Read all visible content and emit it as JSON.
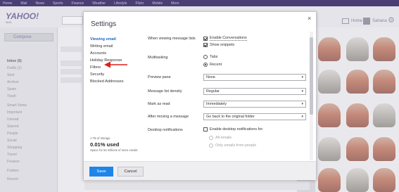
{
  "background": {
    "topnav": [
      "Home",
      "Mail",
      "News",
      "Sports",
      "Finance",
      "Weather",
      "Lifestyle",
      "Flickr",
      "Mobile",
      "More"
    ],
    "logo": "YAHOO!",
    "logo_sub": "MAIL",
    "home_label": "Home",
    "user_label": "Sahana",
    "compose": "Compose",
    "folders": [
      "Inbox (5)",
      "Drafts (1)",
      "Sent",
      "Archive",
      "Spam",
      "Trash",
      "Smart Views",
      "Important",
      "Unread",
      "Starred",
      "People",
      "Social",
      "Shopping",
      "Travel",
      "Finance",
      "Folders",
      "Recent"
    ]
  },
  "settings": {
    "title": "Settings",
    "close": "×",
    "nav": [
      {
        "label": "Viewing email",
        "active": true
      },
      {
        "label": "Writing email",
        "active": false
      },
      {
        "label": "Accounts",
        "active": false
      },
      {
        "label": "Holiday Response",
        "active": false
      },
      {
        "label": "Filters",
        "active": false
      },
      {
        "label": "Security",
        "active": false
      },
      {
        "label": "Blocked Addresses",
        "active": false
      }
    ],
    "storage": {
      "line1": "1 TB of storage",
      "line2": "0.01% used",
      "line3": "Space for 54 millions of more emails"
    },
    "rows": {
      "message_lists": {
        "label": "When viewing message lists",
        "enable_conversations": "Enable Conversations",
        "show_snippets": "Show snippets"
      },
      "multitasking": {
        "label": "Multitasking",
        "tabs": "Tabs",
        "recent": "Recent"
      },
      "preview_pane": {
        "label": "Preview pane",
        "value": "None"
      },
      "density": {
        "label": "Message list density",
        "value": "Regular"
      },
      "mark_as_read": {
        "label": "Mark as read",
        "value": "Immediately"
      },
      "after_moving": {
        "label": "After moving a message",
        "value": "Go back to the original folder"
      },
      "desktop_notifications": {
        "label": "Desktop notifications",
        "enable": "Enable desktop notifications for:",
        "all": "All emails",
        "only": "Only emails from people"
      }
    },
    "save": "Save",
    "cancel": "Cancel",
    "caret": "▾"
  },
  "colors": {
    "accent": "#1e86e8",
    "nav_active": "#1a66c8",
    "arrow": "#d9221b",
    "topnav": "#4a3f75"
  }
}
